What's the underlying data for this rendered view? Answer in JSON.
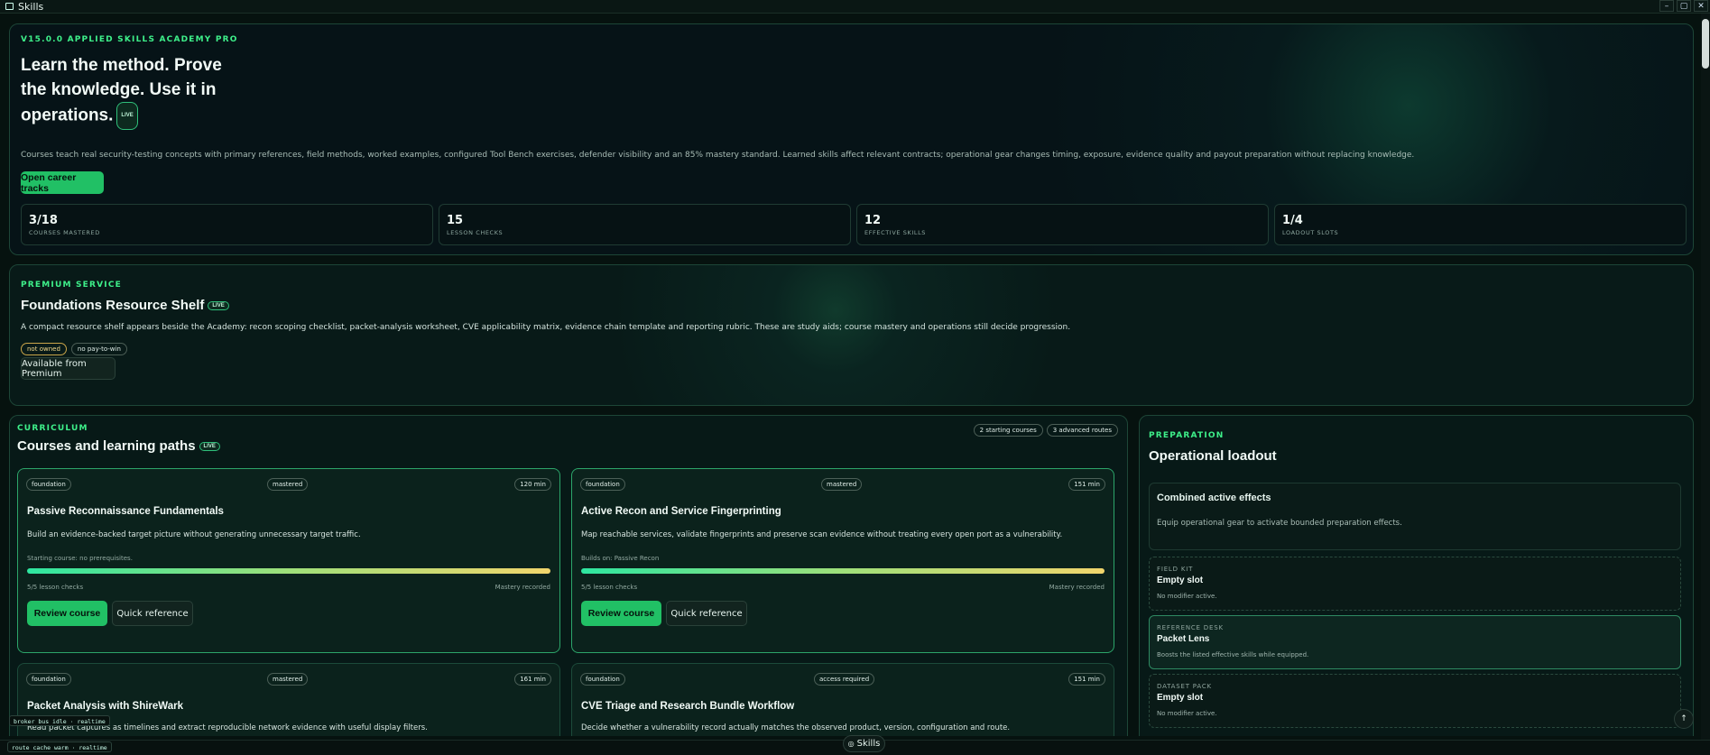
{
  "window": {
    "title": "Skills",
    "controls": [
      "–",
      "▢",
      "✕"
    ]
  },
  "hero": {
    "kicker": "V15.0.0 APPLIED SKILLS ACADEMY PRO",
    "heading_1": "Learn the method. Prove",
    "heading_2": "the knowledge. Use it in",
    "heading_3": "operations.",
    "live": "LIVE",
    "description": "Courses teach real security-testing concepts with primary references, field methods, worked examples, configured Tool Bench exercises, defender visibility and an 85% mastery standard. Learned skills affect relevant contracts; operational gear changes timing, exposure, evidence quality and payout preparation without replacing knowledge.",
    "cta": "Open career tracks",
    "stats": [
      {
        "value": "3/18",
        "label": "COURSES MASTERED"
      },
      {
        "value": "15",
        "label": "LESSON CHECKS"
      },
      {
        "value": "12",
        "label": "EFFECTIVE SKILLS"
      },
      {
        "value": "1/4",
        "label": "LOADOUT SLOTS"
      }
    ]
  },
  "shelf": {
    "kicker": "PREMIUM SERVICE",
    "title": "Foundations Resource Shelf",
    "live": "LIVE",
    "description": "A compact resource shelf appears beside the Academy: recon scoping checklist, packet-analysis worksheet, CVE applicability matrix, evidence chain template and reporting rubric. These are study aids; course mastery and operations still decide progression.",
    "chip_owned": "not owned",
    "chip_p2w": "no pay-to-win",
    "button": "Available from Premium"
  },
  "curriculum": {
    "kicker": "CURRICULUM",
    "title": "Courses and learning paths",
    "live": "LIVE",
    "chip_start": "2 starting courses",
    "chip_adv": "3 advanced routes",
    "courses": [
      {
        "tier": "foundation",
        "status": "mastered",
        "duration": "120 min",
        "title": "Passive Reconnaissance Fundamentals",
        "desc": "Build an evidence-backed target picture without generating unnecessary target traffic.",
        "prereq": "Starting course: no prerequisites.",
        "checks": "5/5 lesson checks",
        "result": "Mastery recorded",
        "progress": 1.0,
        "primary": "Review course",
        "secondary": "Quick reference"
      },
      {
        "tier": "foundation",
        "status": "mastered",
        "duration": "151 min",
        "title": "Active Recon and Service Fingerprinting",
        "desc": "Map reachable services, validate fingerprints and preserve scan evidence without treating every open port as a vulnerability.",
        "prereq": "Builds on: Passive Recon",
        "checks": "5/5 lesson checks",
        "result": "Mastery recorded",
        "progress": 1.0,
        "primary": "Review course",
        "secondary": "Quick reference"
      },
      {
        "tier": "foundation",
        "status": "mastered",
        "duration": "161 min",
        "title": "Packet Analysis with ShireWark",
        "desc": "Read packet captures as timelines and extract reproducible network evidence with useful display filters."
      },
      {
        "tier": "foundation",
        "status": "access required",
        "duration": "151 min",
        "title": "CVE Triage and Research Bundle Workflow",
        "desc": "Decide whether a vulnerability record actually matches the observed product, version, configuration and route."
      }
    ]
  },
  "preparation": {
    "kicker": "PREPARATION",
    "title": "Operational loadout",
    "effects_title": "Combined active effects",
    "effects_desc": "Equip operational gear to activate bounded preparation effects.",
    "slots": [
      {
        "kind": "FIELD KIT",
        "name": "Empty slot",
        "desc": "No modifier active."
      },
      {
        "kind": "REFERENCE DESK",
        "name": "Packet Lens",
        "desc": "Boosts the listed effective skills while equipped."
      },
      {
        "kind": "DATASET PACK",
        "name": "Empty slot",
        "desc": "No modifier active."
      }
    ]
  },
  "toasts": {
    "broker": "broker bus idle · realtime",
    "cache": "route cache warm · realtime"
  },
  "bottom": {
    "skills_tab": "Skills",
    "fab": "↑"
  }
}
